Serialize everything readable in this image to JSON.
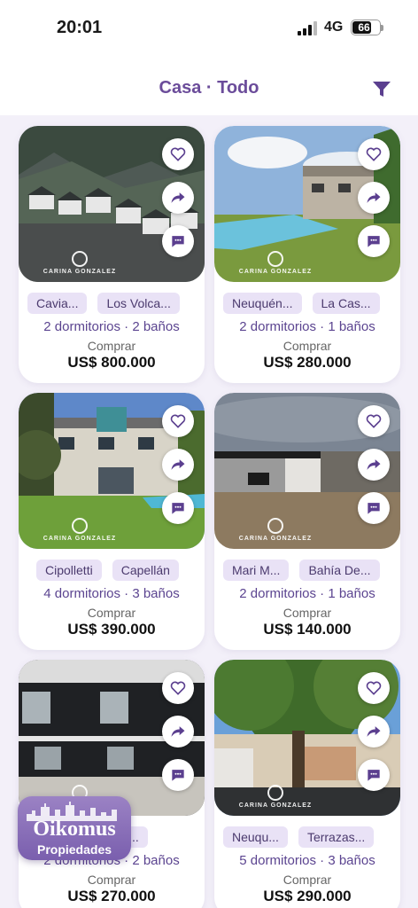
{
  "status_bar": {
    "time": "20:01",
    "network": "4G",
    "battery": "66",
    "battery_level": 0.66
  },
  "header": {
    "title": "Casa · Todo",
    "filter_icon": "filter-icon"
  },
  "colors": {
    "accent": "#6b4c9a",
    "chip_bg": "#e9e2f6",
    "feed_bg": "#f3f0f9"
  },
  "watermark": "CARINA GONZALEZ",
  "cards": [
    {
      "chips": [
        "Cavia...",
        "Los Volca..."
      ],
      "rooms": "2 dormitorios · 2 baños",
      "operation": "Comprar",
      "price": "US$ 800.000"
    },
    {
      "chips": [
        "Neuquén...",
        "La Cas..."
      ],
      "rooms": "2 dormitorios · 1 baños",
      "operation": "Comprar",
      "price": "US$ 280.000"
    },
    {
      "chips": [
        "Cipolletti",
        "Capellán"
      ],
      "rooms": "4 dormitorios · 3 baños",
      "operation": "Comprar",
      "price": "US$ 390.000"
    },
    {
      "chips": [
        "Mari M...",
        "Bahía De..."
      ],
      "rooms": "2 dormitorios · 1 baños",
      "operation": "Comprar",
      "price": "US$ 140.000"
    },
    {
      "chips": [
        "...",
        "Conflu..."
      ],
      "rooms": "2 dormitorios · 2 baños",
      "operation": "Comprar",
      "price": "US$ 270.000"
    },
    {
      "chips": [
        "Neuqu...",
        "Terrazas..."
      ],
      "rooms": "5 dormitorios · 3 baños",
      "operation": "Comprar",
      "price": "US$ 290.000"
    }
  ],
  "brand_badge": {
    "name": "Oikomus",
    "subtitle": "Propiedades"
  }
}
